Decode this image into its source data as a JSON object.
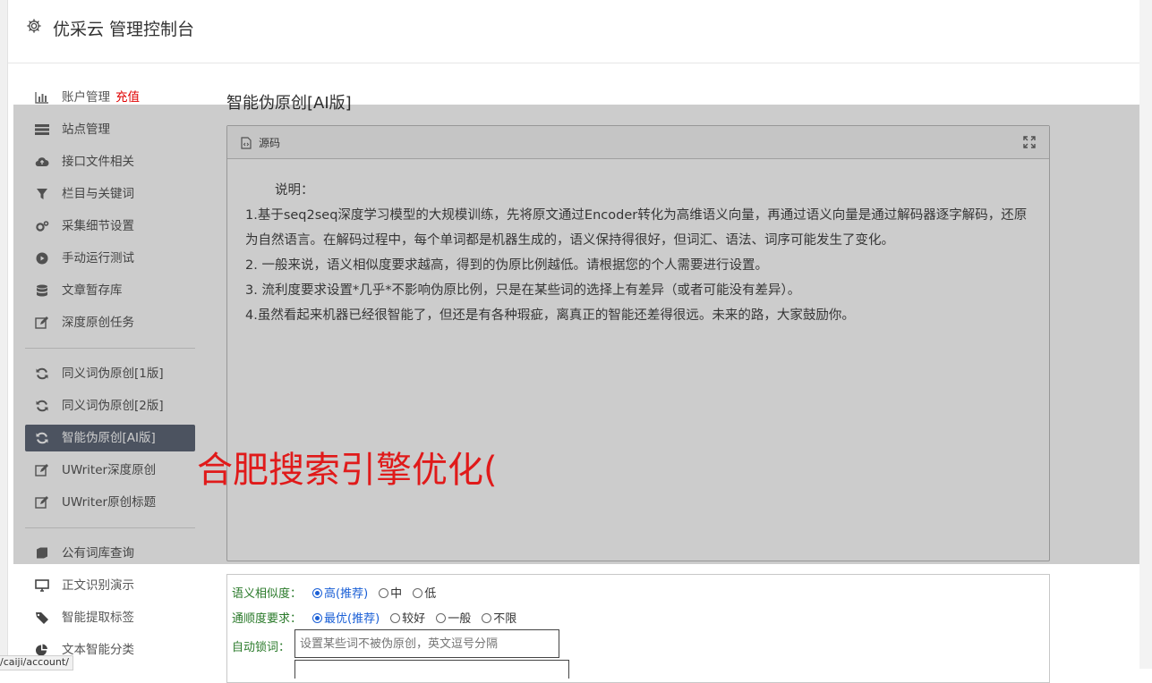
{
  "header": {
    "title": "优采云 管理控制台"
  },
  "sidebar": {
    "items": [
      {
        "label": "账户管理",
        "extra": "充值",
        "icon": "bar-chart-icon"
      },
      {
        "label": "站点管理",
        "icon": "list-icon"
      },
      {
        "label": "接口文件相关",
        "icon": "cloud-upload-icon"
      },
      {
        "label": "栏目与关键词",
        "icon": "filter-icon"
      },
      {
        "label": "采集细节设置",
        "icon": "gears-icon"
      },
      {
        "label": "手动运行测试",
        "icon": "play-icon"
      },
      {
        "label": "文章暂存库",
        "icon": "database-icon"
      },
      {
        "label": "深度原创任务",
        "icon": "edit-icon"
      },
      {
        "label": "同义词伪原创[1版]",
        "icon": "refresh-icon"
      },
      {
        "label": "同义词伪原创[2版]",
        "icon": "refresh-icon"
      },
      {
        "label": "智能伪原创[AI版]",
        "icon": "refresh-icon"
      },
      {
        "label": "UWriter深度原创",
        "icon": "edit-icon"
      },
      {
        "label": "UWriter原创标题",
        "icon": "edit-icon"
      },
      {
        "label": "公有词库查询",
        "icon": "book-icon"
      },
      {
        "label": "正文识别演示",
        "icon": "monitor-icon"
      },
      {
        "label": "智能提取标签",
        "icon": "tag-icon"
      },
      {
        "label": "文本智能分类",
        "icon": "pie-chart-icon"
      }
    ],
    "active": "智能伪原创[AI版]"
  },
  "main": {
    "title": "智能伪原创[AI版]",
    "panel": {
      "label": "源码",
      "note_title": "说明：",
      "lines": [
        "1.基于seq2seq深度学习模型的大规模训练，先将原文通过Encoder转化为高维语义向量，再通过语义向量是通过解码器逐字解码，还原为自然语言。在解码过程中，每个单词都是机器生成的，语义保持得很好，但词汇、语法、词序可能发生了变化。",
        "2. 一般来说，语义相似度要求越高，得到的伪原比例越低。请根据您的个人需要进行设置。",
        "3. 流利度要求设置*几乎*不影响伪原比例，只是在某些词的选择上有差异（或者可能没有差异）。",
        "4.虽然看起来机器已经很智能了，但还是有各种瑕疵，离真正的智能还差得很远。未来的路，大家鼓励你。"
      ]
    },
    "settings": {
      "similarity": {
        "label": "语义相似度：",
        "options": [
          "高(推荐)",
          "中",
          "低"
        ],
        "selected": "高(推荐)"
      },
      "fluency": {
        "label": "通顺度要求：",
        "options": [
          "最优(推荐)",
          "较好",
          "一般",
          "不限"
        ],
        "selected": "最优(推荐)"
      },
      "lock": {
        "label": "自动锁词：",
        "placeholder": "设置某些词不被伪原创，英文逗号分隔"
      }
    }
  },
  "watermark": "合肥搜索引擎优化(",
  "status_url": "/caiji/account/"
}
